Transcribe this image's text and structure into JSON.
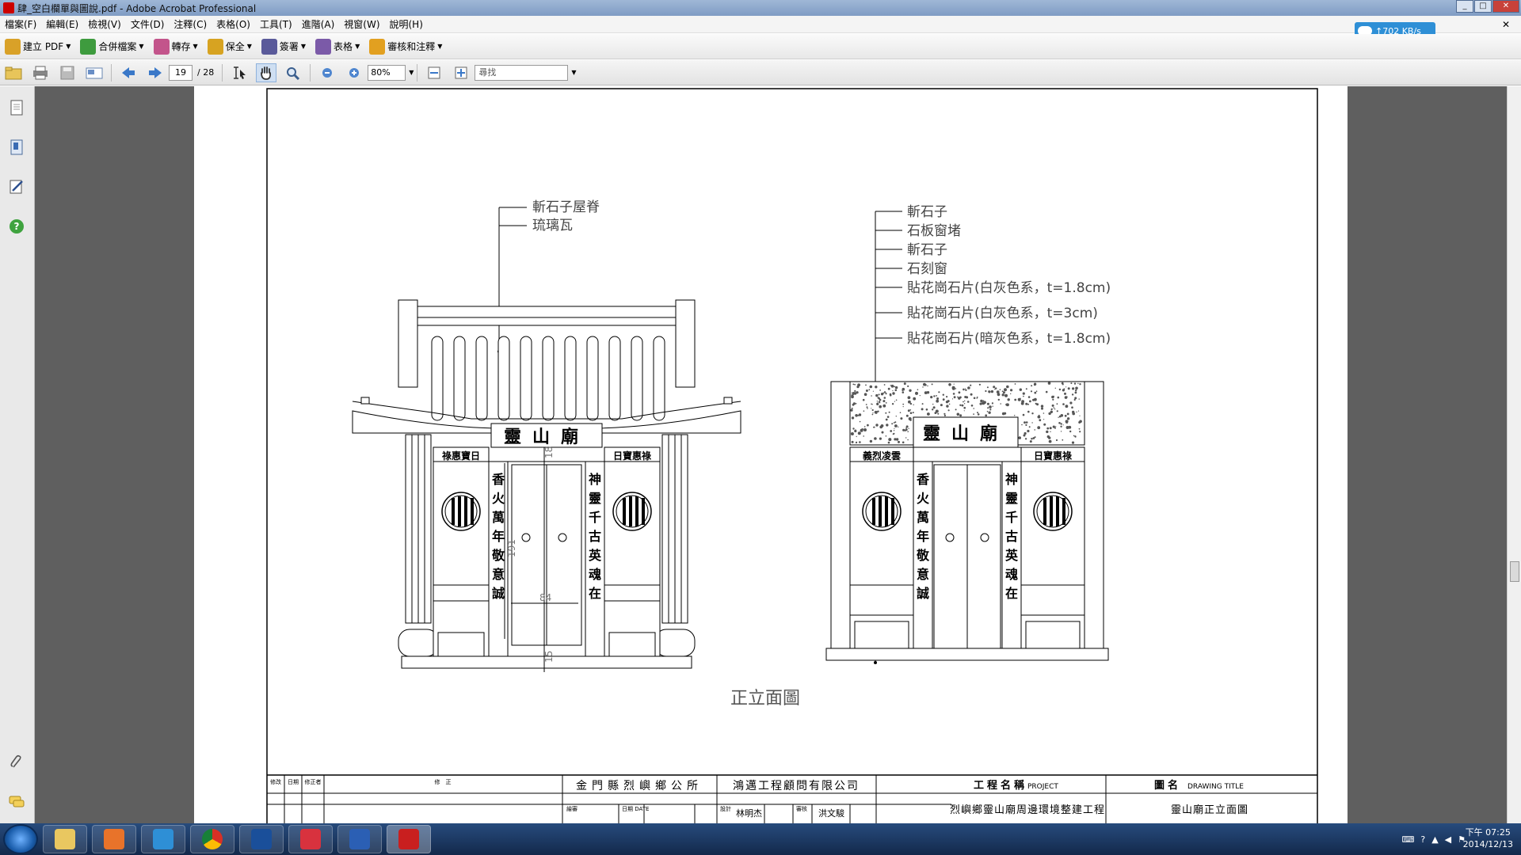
{
  "window": {
    "title": "肆_空白欄單與圖說.pdf - Adobe Acrobat Professional",
    "min": "_",
    "max": "□",
    "close": "✕"
  },
  "menu": [
    "檔案(F)",
    "編輯(E)",
    "檢視(V)",
    "文件(D)",
    "注釋(C)",
    "表格(O)",
    "工具(T)",
    "進階(A)",
    "視窗(W)",
    "說明(H)"
  ],
  "menu_close": "✕",
  "speed": "↑702 KB/s",
  "toolbar1": [
    {
      "label": "建立 PDF",
      "icon": "create-pdf-icon",
      "color": "#d9a128"
    },
    {
      "label": "合併檔案",
      "icon": "combine-files-icon",
      "color": "#3e9b3e"
    },
    {
      "label": "轉存",
      "icon": "export-icon",
      "color": "#c3548b"
    },
    {
      "label": "保全",
      "icon": "lock-icon",
      "color": "#d7a321"
    },
    {
      "label": "簽署",
      "icon": "sign-pen-icon",
      "color": "#5a5a9a"
    },
    {
      "label": "表格",
      "icon": "form-icon",
      "color": "#7b5aa8"
    },
    {
      "label": "審核和注釋",
      "icon": "review-comment-icon",
      "color": "#e2a020"
    }
  ],
  "nav": {
    "page": "19",
    "total": "/ 28",
    "zoom": "80%",
    "find": "尋找"
  },
  "drawing": {
    "callout_left": [
      "斬石子屋脊",
      "琉璃瓦"
    ],
    "callout_right": [
      "斬石子",
      "石板窗堵",
      "斬石子",
      "石刻窗",
      "貼花崗石片(白灰色系，t=1.8cm)",
      "貼花崗石片(白灰色系，t=3cm)",
      "貼花崗石片(暗灰色系，t=1.8cm)"
    ],
    "plaque": "靈山廟",
    "left_side_plaque": "祿惠寶日",
    "right_side_plaque": "日寶惠祿",
    "left_side_plaque_r": "義烈凌雲",
    "right_side_plaque_r": "日寶惠祿",
    "couplet_left": [
      "香",
      "火",
      "萬",
      "年",
      "敬",
      "意",
      "誠"
    ],
    "couplet_right": [
      "神",
      "靈",
      "千",
      "古",
      "英",
      "魂",
      "在"
    ],
    "dims": [
      "18",
      "191",
      "84",
      "15"
    ],
    "caption": "正立面圖"
  },
  "titleblock": {
    "h1": "修改",
    "h1b": "日期",
    "h1c": "修正者",
    "h1d": "修　正",
    "owner": "金門縣烈嶼鄉公所",
    "firm": "鴻邁工程顧問有限公司",
    "project_label": "工程名稱",
    "project_label_en": "PROJECT",
    "title_label": "圖名",
    "title_label_en": "DRAWING TITLE",
    "project": "烈嶼鄉靈山廟周邊環境整建工程",
    "drawing_title": "靈山廟正立面圖",
    "row_label_a": "繪審",
    "row_label_b": "日期 DATE",
    "person1": "林明杰",
    "person2": "洪文駿",
    "design": "設計",
    "review": "審核"
  },
  "clock": {
    "time": "下午 07:25",
    "date": "2014/12/13"
  }
}
